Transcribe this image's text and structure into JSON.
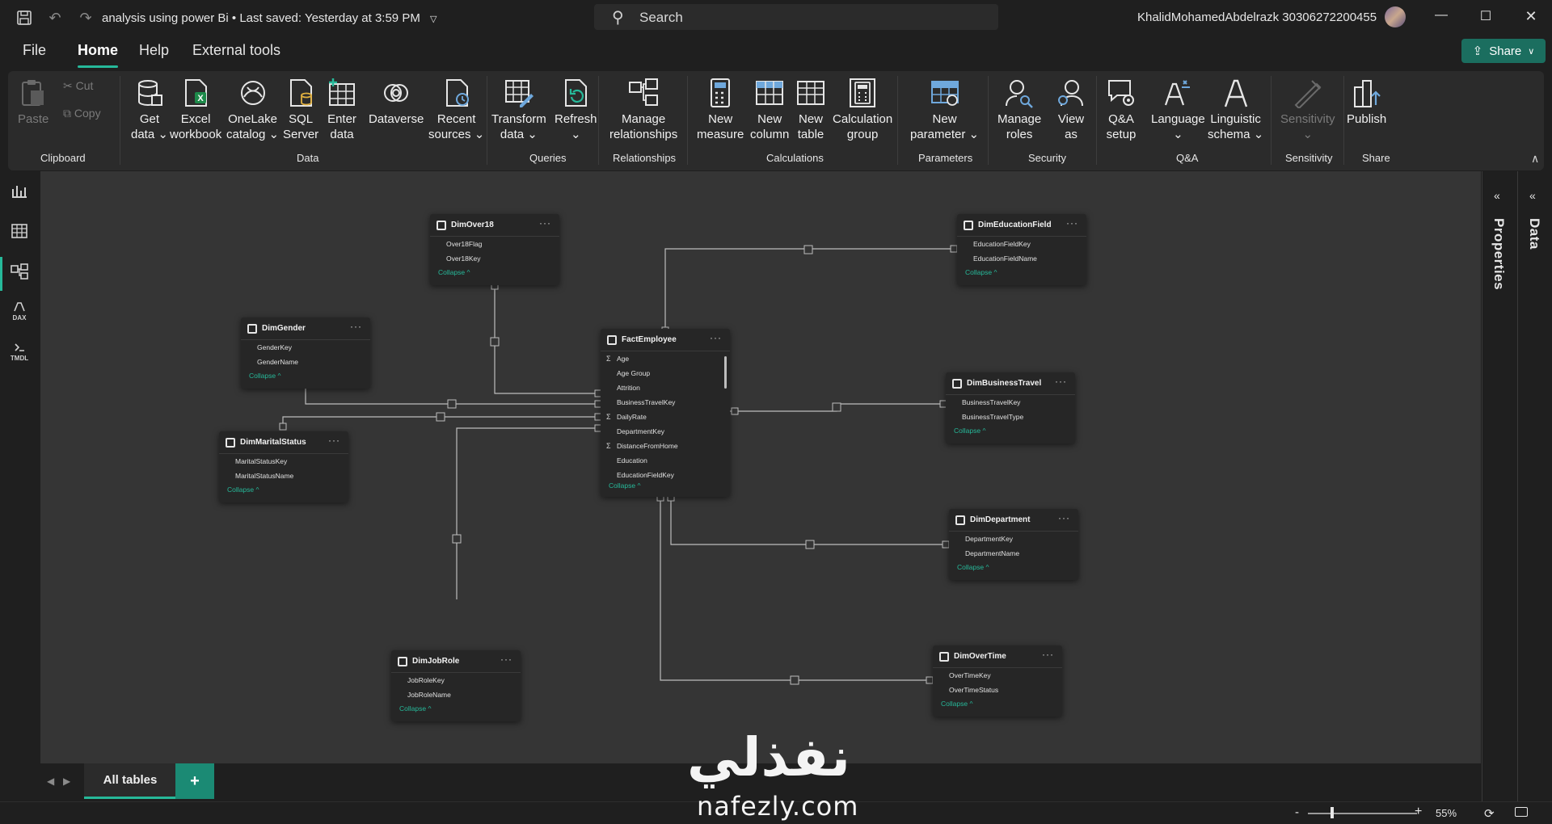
{
  "titlebar": {
    "doc_title": "analysis using power Bi",
    "saved_status": "Last saved: Yesterday at 3:59 PM",
    "search_placeholder": "Search",
    "user_name": "KhalidMohamedAbdelrazk 30306272200455",
    "icons": [
      "save-icon",
      "undo-icon",
      "redo-icon",
      "minimize-icon",
      "maximize-icon",
      "close-icon"
    ]
  },
  "menu": {
    "items": [
      "File",
      "Home",
      "Help",
      "External tools"
    ],
    "active": "Home",
    "share_label": "Share"
  },
  "ribbon": {
    "clipboard": {
      "paste": "Paste",
      "cut": "Cut",
      "copy": "Copy",
      "group": "Clipboard"
    },
    "data": {
      "get_data": [
        "Get",
        "data"
      ],
      "excel": [
        "Excel",
        "workbook"
      ],
      "onelake": [
        "OneLake",
        "catalog"
      ],
      "sql": [
        "SQL",
        "Server"
      ],
      "enter": [
        "Enter",
        "data"
      ],
      "dataverse": "Dataverse",
      "recent": [
        "Recent",
        "sources"
      ],
      "group": "Data"
    },
    "queries": {
      "transform": [
        "Transform",
        "data"
      ],
      "refresh": "Refresh",
      "group": "Queries"
    },
    "relationships": {
      "manage": [
        "Manage",
        "relationships"
      ],
      "group": "Relationships"
    },
    "calculations": {
      "new_measure": [
        "New",
        "measure"
      ],
      "new_column": [
        "New",
        "column"
      ],
      "new_table": [
        "New",
        "table"
      ],
      "calc_group": [
        "Calculation",
        "group"
      ],
      "group": "Calculations"
    },
    "parameters": {
      "new_param": [
        "New",
        "parameter"
      ],
      "group": "Parameters"
    },
    "security": {
      "manage_roles": [
        "Manage",
        "roles"
      ],
      "view_as": [
        "View",
        "as"
      ],
      "group": "Security"
    },
    "qa": {
      "qa_setup": [
        "Q&A",
        "setup"
      ],
      "language": "Language",
      "ling": [
        "Linguistic",
        "schema"
      ],
      "group": "Q&A"
    },
    "sensitivity": {
      "label": "Sensitivity",
      "group": "Sensitivity"
    },
    "share": {
      "publish": "Publish",
      "group": "Share"
    }
  },
  "left_nav": {
    "items": [
      "report-view-icon",
      "table-view-icon",
      "model-view-icon",
      "dax-query-view-icon",
      "tmdl-view-icon"
    ],
    "dax_label": "DAX",
    "tmdl_label": "TMDL",
    "active": "model-view-icon"
  },
  "right_panes": {
    "properties": "Properties",
    "data": "Data"
  },
  "tables": {
    "DimOver18": {
      "name": "DimOver18",
      "fields": [
        "Over18Flag",
        "Over18Key"
      ]
    },
    "DimEducationField": {
      "name": "DimEducationField",
      "fields": [
        "EducationFieldKey",
        "EducationFieldName"
      ]
    },
    "DimGender": {
      "name": "DimGender",
      "fields": [
        "GenderKey",
        "GenderName"
      ]
    },
    "FactEmployee": {
      "name": "FactEmployee",
      "fields": [
        "Age",
        "Age Group",
        "Attrition",
        "BusinessTravelKey",
        "DailyRate",
        "DepartmentKey",
        "DistanceFromHome",
        "Education",
        "EducationFieldKey"
      ],
      "sigma_flags": [
        true,
        false,
        false,
        false,
        true,
        false,
        true,
        false,
        false
      ]
    },
    "DimBusinessTravel": {
      "name": "DimBusinessTravel",
      "fields": [
        "BusinessTravelKey",
        "BusinessTravelType"
      ]
    },
    "DimMaritalStatus": {
      "name": "DimMaritalStatus",
      "fields": [
        "MaritalStatusKey",
        "MaritalStatusName"
      ]
    },
    "DimDepartment": {
      "name": "DimDepartment",
      "fields": [
        "DepartmentKey",
        "DepartmentName"
      ]
    },
    "DimJobRole": {
      "name": "DimJobRole",
      "fields": [
        "JobRoleKey",
        "JobRoleName"
      ]
    },
    "DimOverTime": {
      "name": "DimOverTime",
      "fields": [
        "OverTimeKey",
        "OverTimeStatus"
      ]
    },
    "collapse_label": "Collapse"
  },
  "tabs": {
    "all_tables": "All tables",
    "add": "+"
  },
  "status": {
    "zoom": "55%",
    "zoom_level": 0.55
  },
  "watermark": {
    "arabic": "نفذلي",
    "latin": "nafezly.com"
  }
}
